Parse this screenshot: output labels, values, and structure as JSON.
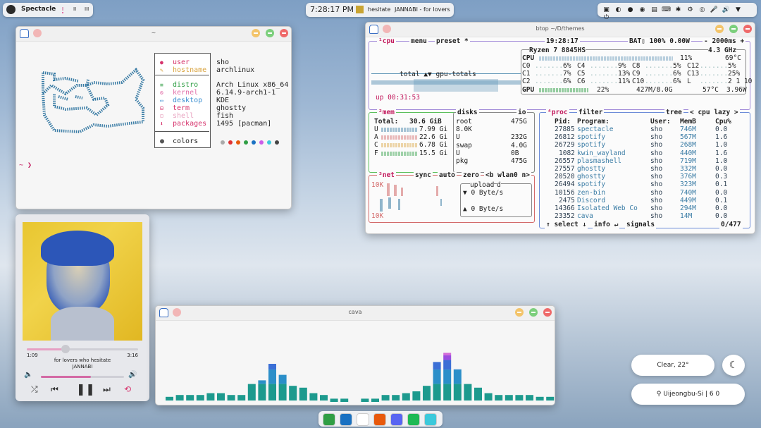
{
  "top_left_panel": {
    "app_name": "Spectacle",
    "desktops": [
      "I",
      "II",
      "III"
    ]
  },
  "top_center_panel": {
    "clock": "7:28:17 PM",
    "song": "hesitate",
    "artist_title": "JANNABI - for lovers w"
  },
  "tray": {
    "icons": [
      "screenshot-icon",
      "theme-icon",
      "spotify-icon",
      "camera-icon",
      "clipboard-icon",
      "keyboard-icon",
      "bluetooth-icon",
      "settings-icon",
      "steam-icon",
      "microphone-icon",
      "volume-icon",
      "wifi-icon",
      "power-icon"
    ]
  },
  "fastfetch": {
    "title": "~",
    "labels": [
      {
        "key": "user",
        "value": "sho",
        "color": "#d6336c"
      },
      {
        "key": "hostname",
        "value": "archlinux",
        "color": "#d9a441"
      },
      {
        "key": "distro",
        "value": "Arch Linux x86_64",
        "color": "#2f9e44"
      },
      {
        "key": "kernel",
        "value": "6.14.9-arch1-1",
        "color": "#e26fa8"
      },
      {
        "key": "desktop",
        "value": "KDE",
        "color": "#3b8fd1"
      },
      {
        "key": "term",
        "value": "ghostty",
        "color": "#d6336c"
      },
      {
        "key": "shell",
        "value": "fish",
        "color": "#e8a3c0"
      },
      {
        "key": "packages",
        "value": "1495 [pacman]",
        "color": "#d6336c"
      }
    ],
    "colors_label": "colors",
    "palette": [
      "#aaaaaa",
      "#e03131",
      "#e8590c",
      "#2f9e44",
      "#1971c2",
      "#cc5de8",
      "#3bc9db",
      "#444444"
    ],
    "prompt": "~ ❯"
  },
  "btop": {
    "title": "btop ~/D/themes",
    "header": {
      "cpu_tab": "¹cpu",
      "menu": "menu",
      "preset": "preset *",
      "time": "19:28:17",
      "bat": "BAT▯ 100% 0.00W",
      "refresh": "- 2000ms +"
    },
    "cpu_model": "Ryzen 7 8845HS",
    "freq": "4.3 GHz",
    "cpu_total": {
      "label": "CPU",
      "pct": "11%",
      "temp": "69°C"
    },
    "cores": [
      [
        "C0",
        "6%",
        "C4",
        "9%",
        "C8",
        "5%",
        "C12",
        "5%"
      ],
      [
        "C1",
        "7%",
        "C5",
        "13%",
        "C9",
        "6%",
        "C13",
        "25%"
      ],
      [
        "C2",
        "6%",
        "C6",
        "11%",
        "C10",
        "6%",
        "L",
        "2 1 10"
      ]
    ],
    "gpu": {
      "label": "GPU",
      "pct": "22%",
      "mem": "427M/8.0G",
      "temp": "57°C",
      "power": "3.96W"
    },
    "graph_label": "total ▲▼ gpu-totals",
    "uptime": "up 00:31:53",
    "mem": {
      "tab": "²mem",
      "total_label": "Total:",
      "total": "30.6 GiB",
      "rows": [
        [
          "U",
          "7.99 Gi"
        ],
        [
          "A",
          "22.6 Gi"
        ],
        [
          "C",
          "6.78 Gi"
        ],
        [
          "F",
          "15.5 Gi"
        ]
      ]
    },
    "disks": {
      "tab": "disks",
      "io": "io",
      "rows": [
        [
          "root",
          "475G"
        ],
        [
          "8.0K",
          ""
        ],
        [
          "U",
          "232G"
        ],
        [
          "swap",
          "4.0G"
        ],
        [
          "U",
          "0B"
        ],
        [
          "pkg",
          "475G"
        ]
      ]
    },
    "net": {
      "tab": "³net",
      "sync": "sync",
      "auto": "auto",
      "zero": "zero",
      "iface": "<b wlan0 n>",
      "top": "10K",
      "bottom": "10K",
      "upload": "upload",
      "download": "d",
      "up_rate": "▼ 0 Byte/s",
      "down_rate": "▲ 0 Byte/s"
    },
    "proc": {
      "tab": "⁴proc",
      "filter": "filter",
      "tree": "tree",
      "mode": "< cpu lazy >",
      "columns": [
        "Pid:",
        "Program:",
        "User:",
        "MemB",
        "Cpu%"
      ],
      "rows": [
        [
          "27885",
          "spectacle",
          "sho",
          "746M",
          "0.0"
        ],
        [
          "26812",
          "spotify",
          "sho",
          "567M",
          "1.6"
        ],
        [
          "26729",
          "spotify",
          "sho",
          "268M",
          "1.0"
        ],
        [
          "1082",
          "kwin_wayland",
          "sho",
          "440M",
          "1.6"
        ],
        [
          "26557",
          "plasmashell",
          "sho",
          "719M",
          "1.0"
        ],
        [
          "27557",
          "ghostty",
          "sho",
          "332M",
          "0.0"
        ],
        [
          "20520",
          "ghostty",
          "sho",
          "376M",
          "0.3"
        ],
        [
          "26494",
          "spotify",
          "sho",
          "323M",
          "0.1"
        ],
        [
          "10156",
          "zen-bin",
          "sho",
          "740M",
          "0.0"
        ],
        [
          "2475",
          "Discord",
          "sho",
          "449M",
          "0.1"
        ],
        [
          "14366",
          "Isolated Web Co",
          "sho",
          "294M",
          "0.0"
        ],
        [
          "23352",
          "cava",
          "sho",
          "14M",
          "0.0"
        ]
      ],
      "footer_select": "↑ select ↓",
      "footer_info": "info ↵",
      "footer_signals": "signals",
      "count": "0/477"
    }
  },
  "player": {
    "elapsed": "1:09",
    "duration": "3:16",
    "progress": 0.35,
    "song": "for lovers who hesitate",
    "artist": "JANNABI",
    "volume": 0.6
  },
  "cava": {
    "title": "cava",
    "values": [
      2,
      3,
      3,
      3,
      4,
      4,
      3,
      3,
      9,
      11,
      20,
      14,
      8,
      7,
      4,
      3,
      1,
      1,
      0,
      1,
      1,
      3,
      3,
      4,
      5,
      8,
      21,
      26,
      17,
      9,
      7,
      4,
      3,
      3,
      3,
      3,
      2,
      2
    ]
  },
  "weather": {
    "condition": "Clear, 22°",
    "location": "Uijeongbu-Si | 6 0"
  },
  "dock": {
    "icons": [
      "krita-icon",
      "files-icon",
      "ghostty-icon",
      "firefox-icon",
      "discord-icon",
      "spotify-icon",
      "steam-icon"
    ]
  }
}
